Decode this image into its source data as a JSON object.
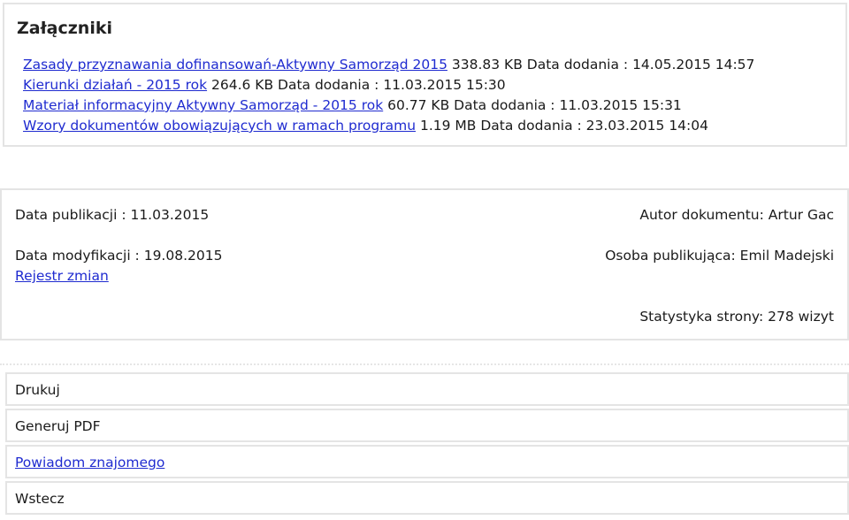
{
  "attachments": {
    "title": "Załączniki",
    "files": [
      {
        "name": "Zasady przyznawania dofinansowań-Aktywny Samorząd 2015",
        "meta": " 338.83 KB Data dodania : 14.05.2015 14:57"
      },
      {
        "name": "Kierunki działań - 2015 rok",
        "meta": " 264.6 KB Data dodania : 11.03.2015 15:30"
      },
      {
        "name": "Materiał informacyjny Aktywny Samorząd - 2015 rok",
        "meta": " 60.77 KB Data dodania : 11.03.2015 15:31"
      },
      {
        "name": "Wzory dokumentów obowiązujących w ramach programu",
        "meta": " 1.19 MB Data dodania : 23.03.2015 14:04"
      }
    ]
  },
  "publication": {
    "published": "Data publikacji : 11.03.2015",
    "author": "Autor dokumentu: Artur Gac",
    "modified": "Data modyfikacji : 19.08.2015",
    "publisher": "Osoba publikująca: Emil Madejski",
    "changelog_link": "Rejestr zmian",
    "stats": "Statystyka strony: 278 wizyt"
  },
  "actions": {
    "print": "Drukuj",
    "pdf": "Generuj PDF",
    "notify": "Powiadom znajomego",
    "back": "Wstecz"
  },
  "colors": {
    "link": "#1f2bd0",
    "border": "#e4e4e4"
  }
}
